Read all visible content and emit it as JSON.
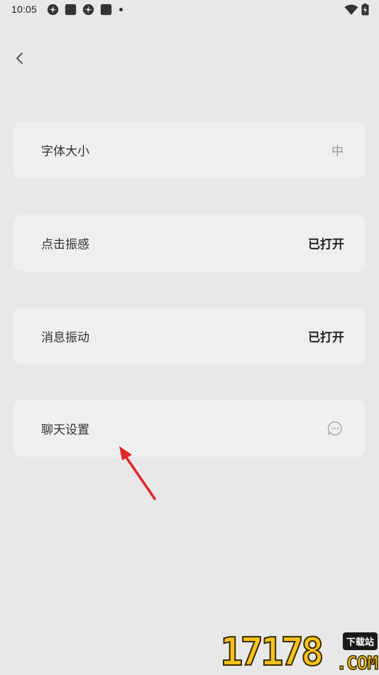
{
  "status_bar": {
    "time": "10:05",
    "left_icons": [
      "pinwheel-icon",
      "square-app-icon",
      "pinwheel-icon",
      "square-app-icon",
      "dot-icon"
    ],
    "right_icons": [
      "wifi-icon",
      "battery-icon"
    ]
  },
  "header": {
    "back_icon": "chevron-left-icon"
  },
  "settings": [
    {
      "label": "字体大小",
      "value": "中"
    },
    {
      "label": "点击振感",
      "value": "已打开"
    },
    {
      "label": "消息振动",
      "value": "已打开"
    },
    {
      "label": "聊天设置",
      "icon": "chat-bubble-icon"
    }
  ],
  "annotation": {
    "arrow_color": "#e0262b"
  },
  "watermark": {
    "digits": "17178",
    "badge": "下载站",
    "domain": ".COM"
  },
  "colors": {
    "background": "#e8e8e8",
    "card": "#efefef",
    "accent_watermark": "#f5c21b"
  }
}
